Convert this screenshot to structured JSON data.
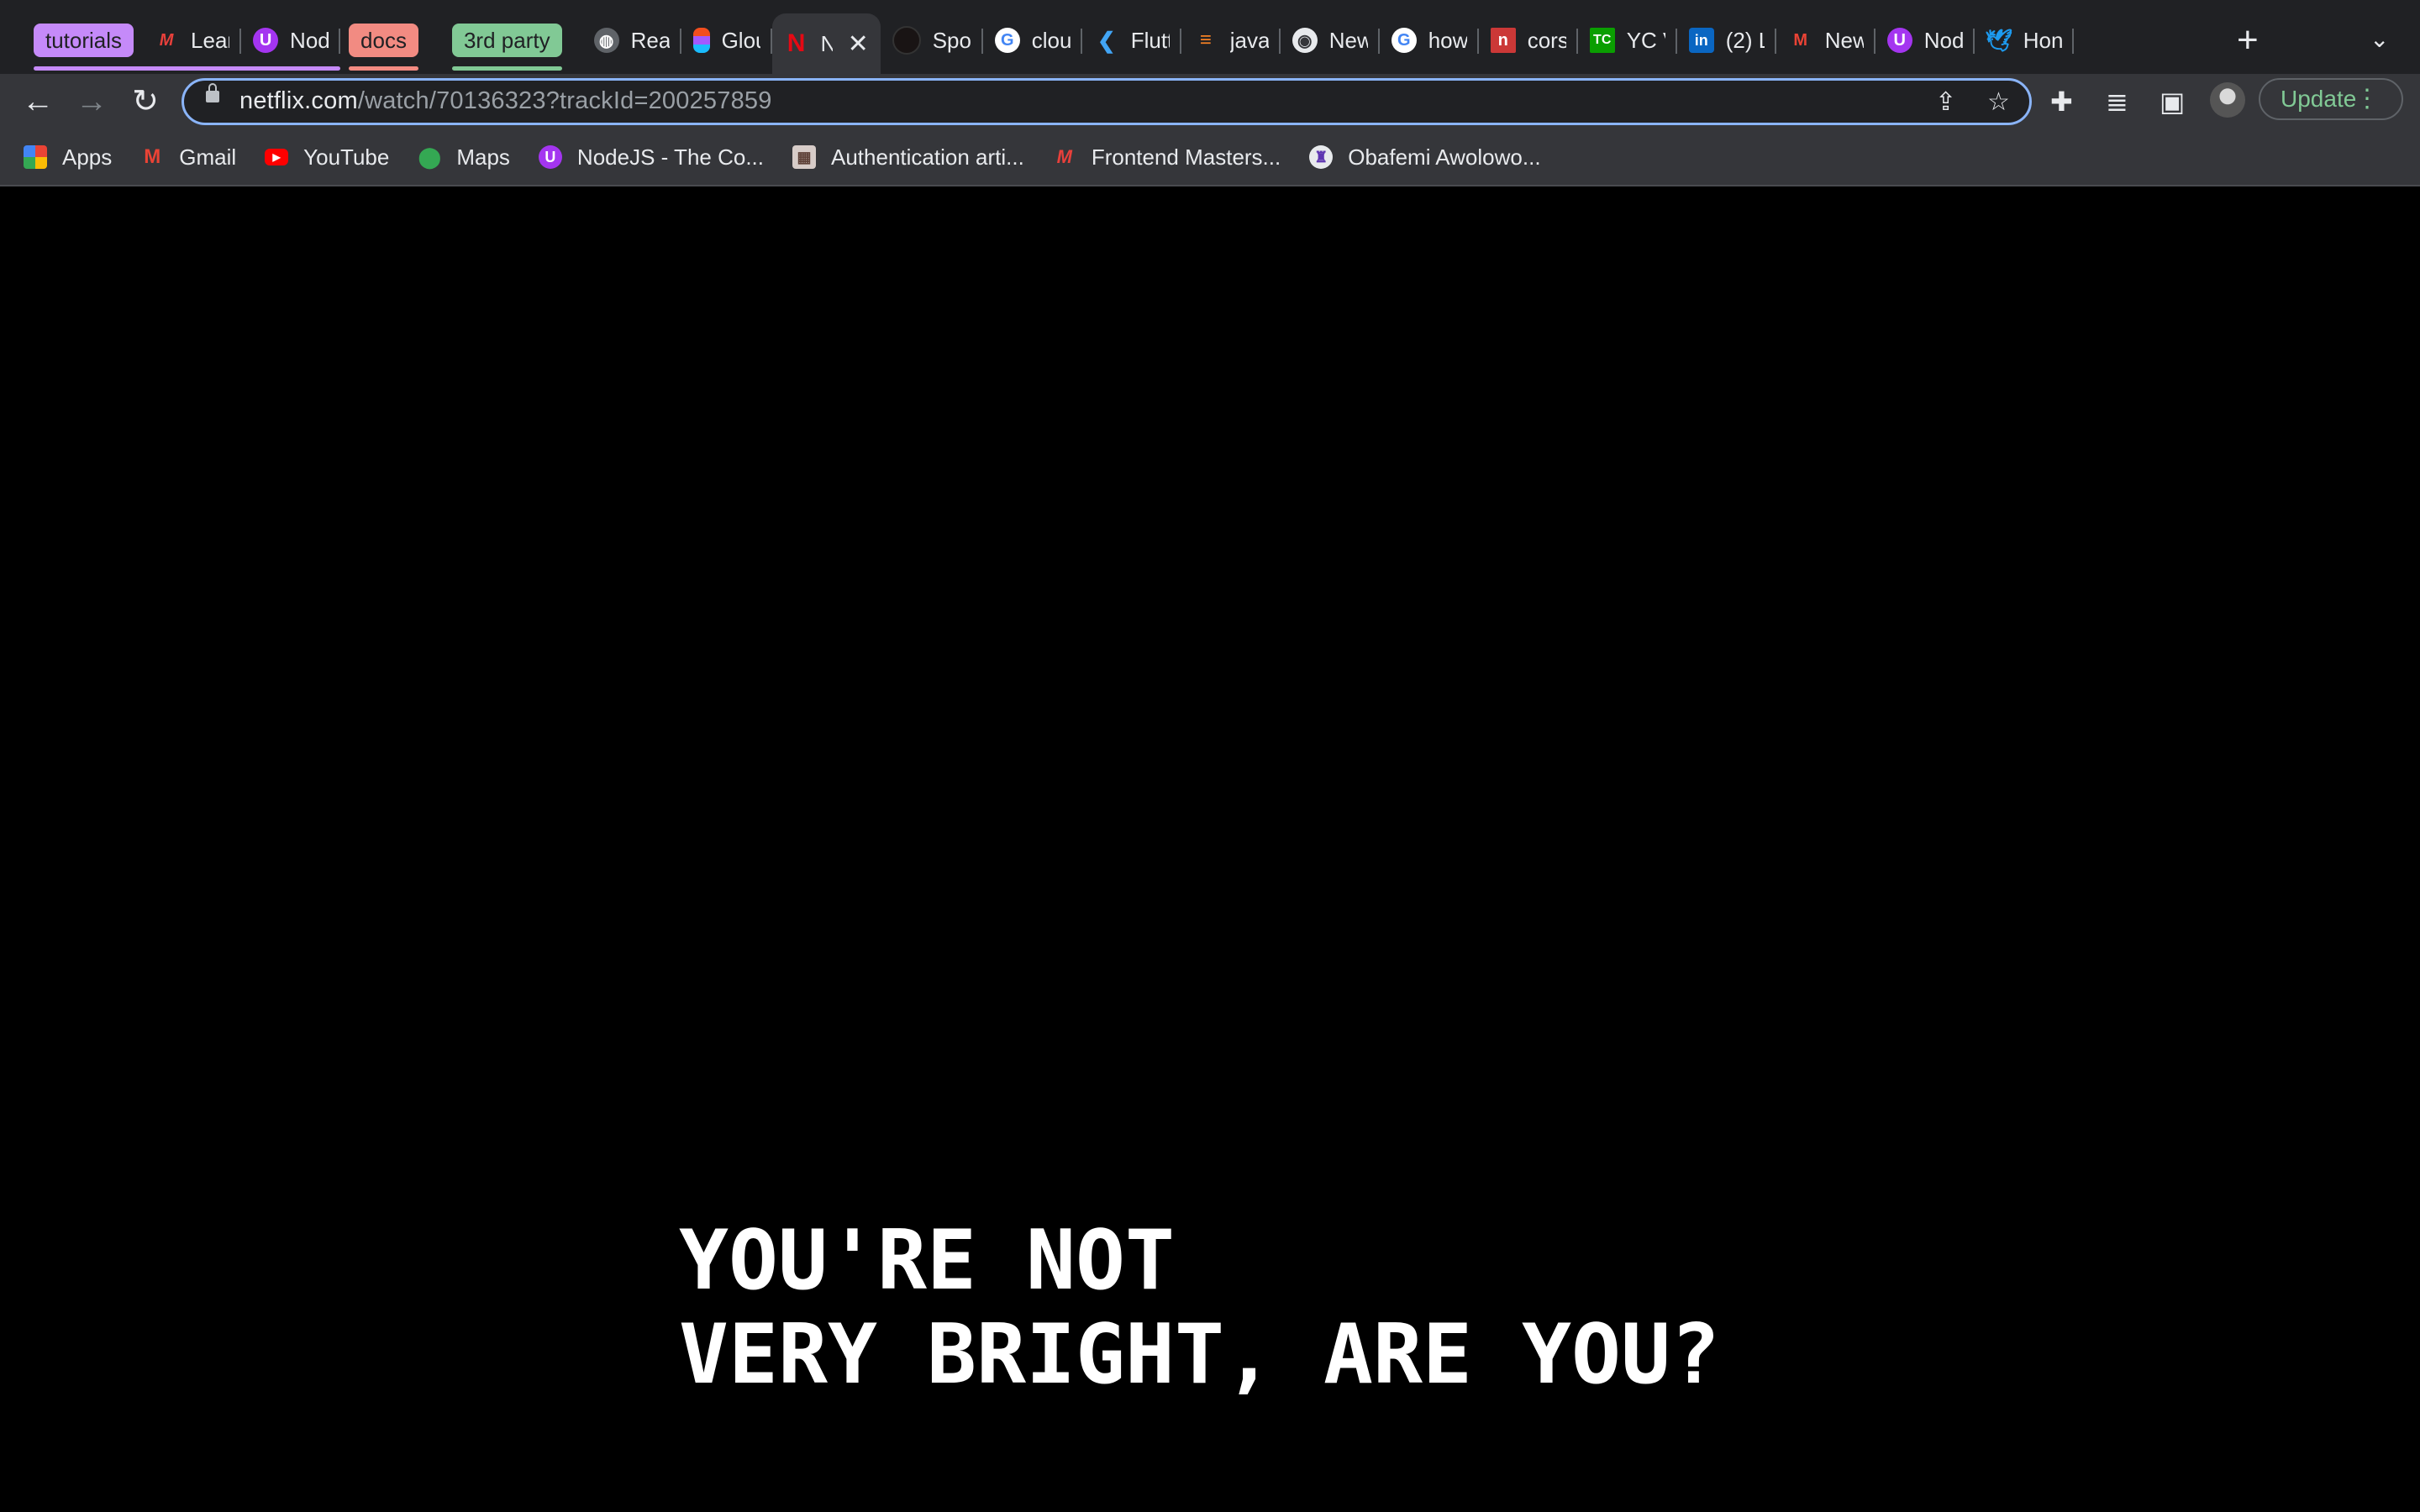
{
  "colors": {
    "tabstrip_bg": "#202124",
    "toolbar_bg": "#35363a",
    "accent_blue": "#8ab4f8",
    "update_green": "#81c995",
    "group_tutorials": "#c58af9",
    "group_docs": "#f28b82",
    "group_third_party": "#81c995"
  },
  "tab_groups": {
    "tutorials": "tutorials",
    "docs": "docs",
    "third_party": "3rd party"
  },
  "tabs": [
    {
      "title": "Lear",
      "icon": "frontend-masters-icon"
    },
    {
      "title": "Nod",
      "icon": "udemy-icon"
    },
    {
      "title": "Reac",
      "icon": "globe-icon"
    },
    {
      "title": "Glou",
      "icon": "figma-icon"
    },
    {
      "title": "N",
      "icon": "netflix-icon",
      "active": true
    },
    {
      "title": "Spot",
      "icon": "spotify-icon"
    },
    {
      "title": "clou",
      "icon": "google-icon"
    },
    {
      "title": "Flutt",
      "icon": "flutter-icon"
    },
    {
      "title": "java",
      "icon": "stackoverflow-icon"
    },
    {
      "title": "New",
      "icon": "chrome-icon"
    },
    {
      "title": "how",
      "icon": "google-icon"
    },
    {
      "title": "cors",
      "icon": "npm-icon"
    },
    {
      "title": "YC V",
      "icon": "techcrunch-icon"
    },
    {
      "title": "(2) L",
      "icon": "linkedin-icon"
    },
    {
      "title": "New",
      "icon": "gmail-icon"
    },
    {
      "title": "Nod",
      "icon": "udemy-icon"
    },
    {
      "title": "Hon",
      "icon": "twitter-icon"
    }
  ],
  "address_bar": {
    "host": "netflix.com",
    "path": "/watch/70136323?trackId=200257859"
  },
  "update_button": "Update",
  "bookmarks": [
    {
      "label": "Apps",
      "icon": "apps-grid-icon"
    },
    {
      "label": "Gmail",
      "icon": "gmail-icon"
    },
    {
      "label": "YouTube",
      "icon": "youtube-icon"
    },
    {
      "label": "Maps",
      "icon": "maps-icon"
    },
    {
      "label": "NodeJS - The Co...",
      "icon": "udemy-icon"
    },
    {
      "label": "Authentication arti...",
      "icon": "article-icon"
    },
    {
      "label": "Frontend Masters...",
      "icon": "frontend-masters-icon"
    },
    {
      "label": "Obafemi Awolowo...",
      "icon": "university-crest-icon"
    }
  ],
  "video": {
    "subtitle_line1": "YOU'RE NOT",
    "subtitle_line2": "VERY BRIGHT, ARE YOU?"
  }
}
